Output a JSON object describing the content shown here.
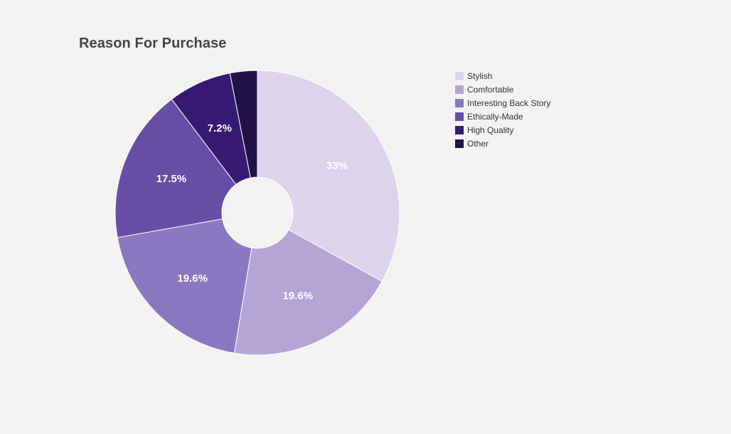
{
  "chart_data": {
    "type": "pie",
    "title": "Reason For Purchase",
    "categories": [
      "Stylish",
      "Comfortable",
      "Interesting Back Story",
      "Ethically-Made",
      "High Quality",
      "Other"
    ],
    "values": [
      33,
      19.6,
      19.6,
      17.5,
      7.2,
      3.1
    ],
    "data_labels": [
      "33%",
      "19.6%",
      "19.6%",
      "17.5%",
      "7.2%",
      ""
    ],
    "colors": [
      "#dcd4eb",
      "#b4a5d6",
      "#8a79c1",
      "#684ea7",
      "#361a74",
      "#211348"
    ],
    "donut": true,
    "legend_position": "right"
  }
}
